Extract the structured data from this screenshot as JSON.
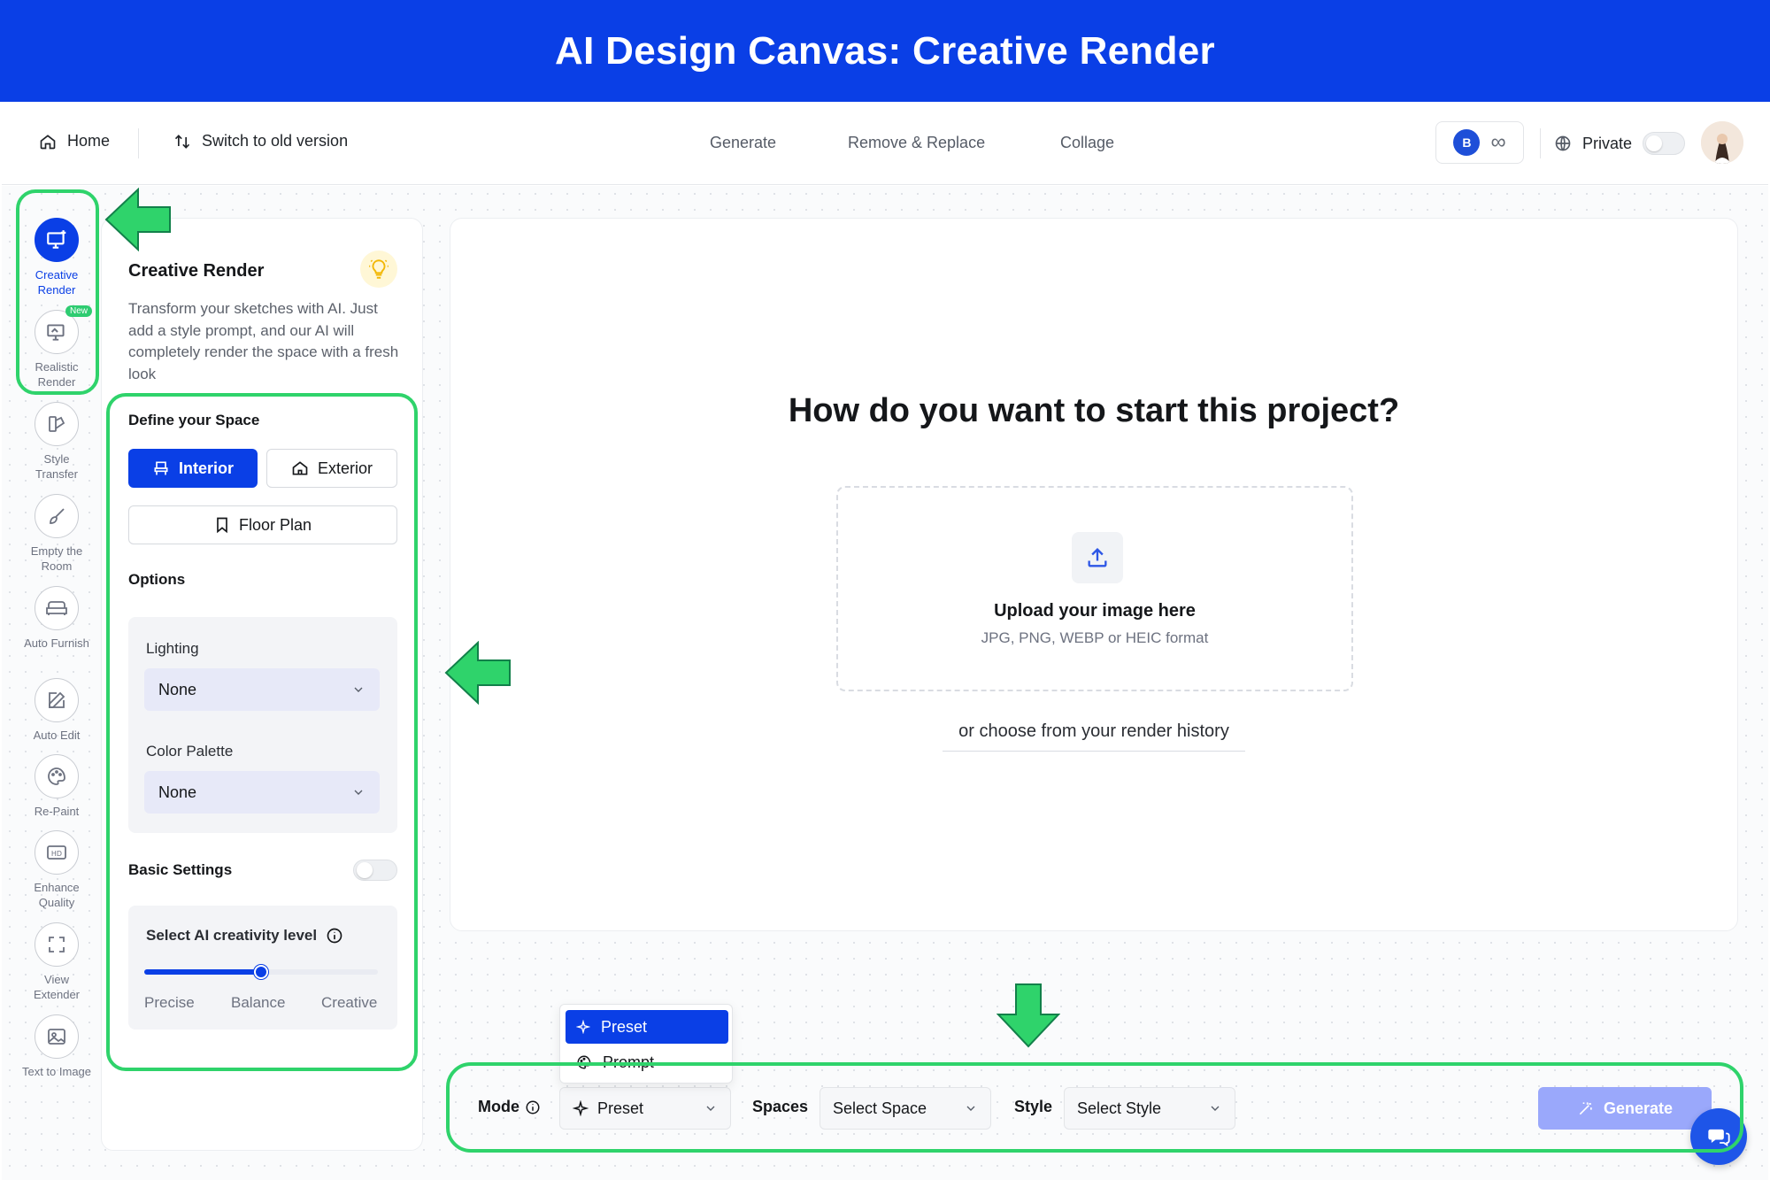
{
  "banner": {
    "title": "AI Design Canvas: Creative Render"
  },
  "nav": {
    "home": "Home",
    "switch": "Switch to old version",
    "tabs": [
      "Generate",
      "Remove & Replace",
      "Collage"
    ],
    "credits_badge": "B",
    "credits_value": "∞",
    "private": "Private"
  },
  "rail": {
    "items": [
      {
        "label": "Creative Render",
        "icon": "creative-render-icon",
        "active": true
      },
      {
        "label": "Realistic Render",
        "icon": "realistic-render-icon",
        "badge": "New"
      },
      {
        "label": "Style Transfer",
        "icon": "style-transfer-icon"
      },
      {
        "label": "Empty the Room",
        "icon": "brush-icon"
      },
      {
        "label": "Auto Furnish",
        "icon": "sofa-icon"
      },
      {
        "label": "Auto Edit",
        "icon": "edit-icon"
      },
      {
        "label": "Re-Paint",
        "icon": "palette-icon"
      },
      {
        "label": "Enhance Quality",
        "icon": "hd-icon"
      },
      {
        "label": "View Extender",
        "icon": "expand-icon"
      },
      {
        "label": "Text to Image",
        "icon": "image-icon"
      }
    ]
  },
  "panel": {
    "title": "Creative Render",
    "description": "Transform your sketches with AI. Just add a style prompt, and our AI will completely render the space with a fresh look",
    "define_label": "Define your Space",
    "interior": "Interior",
    "exterior": "Exterior",
    "floor_plan": "Floor Plan",
    "options_label": "Options",
    "lighting_label": "Lighting",
    "lighting_value": "None",
    "palette_label": "Color Palette",
    "palette_value": "None",
    "basic_settings": "Basic Settings",
    "creativity_label": "Select AI creativity level",
    "creativity_level": 0.5,
    "ticks": [
      "Precise",
      "Balance",
      "Creative"
    ]
  },
  "canvas": {
    "question": "How do you want to start this project?",
    "upload_title": "Upload your image here",
    "upload_formats": "JPG, PNG, WEBP or HEIC format",
    "history": "or choose from your render history"
  },
  "bottom": {
    "mode_label": "Mode",
    "mode_value": "Preset",
    "spaces_label": "Spaces",
    "spaces_value": "Select Space",
    "style_label": "Style",
    "style_value": "Select Style",
    "generate": "Generate",
    "mode_options": [
      "Preset",
      "Prompt"
    ]
  },
  "colors": {
    "accent": "#0a3fe6",
    "highlight": "#2fd36b",
    "generate_disabled": "#9aa8fb"
  }
}
